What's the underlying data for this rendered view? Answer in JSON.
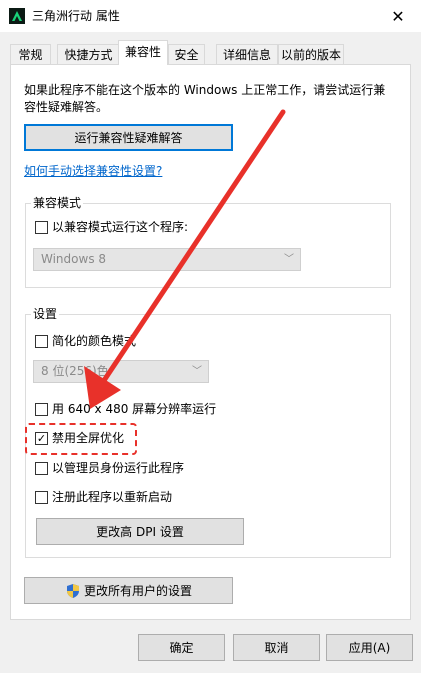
{
  "window": {
    "title": "三角洲行动 属性",
    "close_glyph": "✕"
  },
  "tabs": [
    {
      "label": "常规"
    },
    {
      "label": "快捷方式"
    },
    {
      "label": "兼容性"
    },
    {
      "label": "安全"
    },
    {
      "label": "详细信息"
    },
    {
      "label": "以前的版本"
    }
  ],
  "compat": {
    "description_line1": "如果此程序不能在这个版本的 Windows 上正常工作，请尝试运行兼",
    "description_line2": "容性疑难解答。",
    "troubleshoot_button": "运行兼容性疑难解答",
    "manual_link": "如何手动选择兼容性设置?"
  },
  "compat_mode": {
    "group_label": "兼容模式",
    "checkbox_label": "以兼容模式运行这个程序:",
    "select_value": "Windows 8"
  },
  "settings": {
    "group_label": "设置",
    "reduced_color_label": "简化的颜色模式",
    "color_select_value": "8 位(256)色",
    "res_640_label": "用 640 x 480 屏幕分辨率运行",
    "disable_fullscreen_label": "禁用全屏优化",
    "admin_label": "以管理员身份运行此程序",
    "register_restart_label": "注册此程序以重新启动",
    "dpi_button": "更改高 DPI 设置",
    "check_mark": "✓"
  },
  "all_users_button": "更改所有用户的设置",
  "footer": {
    "ok": "确定",
    "cancel": "取消",
    "apply": "应用(A)"
  },
  "colors": {
    "accent_red": "#e8312a",
    "focus_blue": "#0078d7",
    "link_blue": "#0066cc"
  }
}
